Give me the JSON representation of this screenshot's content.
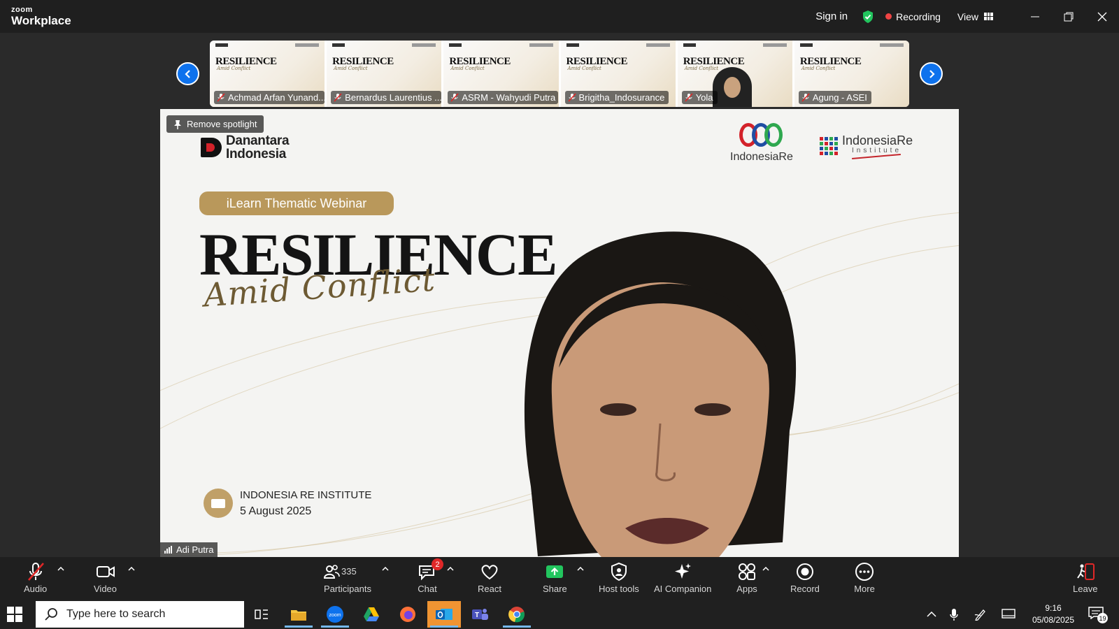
{
  "app": {
    "brand_top": "zoom",
    "brand_bottom": "Workplace"
  },
  "titlebar": {
    "signin": "Sign in",
    "recording": "Recording",
    "view": "View"
  },
  "participants_strip": [
    {
      "name": "Achmad Arfan Yunand..."
    },
    {
      "name": "Bernardus Laurentius ..."
    },
    {
      "name": "ASRM - Wahyudi Putra"
    },
    {
      "name": "Brigitha_Indosurance"
    },
    {
      "name": "Yola"
    },
    {
      "name": "Agung - ASEI"
    }
  ],
  "thumb_slide": {
    "title": "RESILIENCE",
    "sub": "Amid Conflict"
  },
  "stage": {
    "spotlight_btn": "Remove spotlight",
    "sponsor1_line1": "Danantara",
    "sponsor1_line2": "Indonesia",
    "sponsor2": "IndonesiaRe",
    "sponsor3_line1": "IndonesiaRe",
    "sponsor3_line2": "Institute",
    "pill": "iLearn Thematic Webinar",
    "headline": "RESILIENCE",
    "subheadline": "Amid Conflict",
    "venue_line1": "INDONESIA RE INSTITUTE",
    "venue_line2": "5 August 2025",
    "speaker": "Adi Putra"
  },
  "toolbar": {
    "audio": "Audio",
    "video": "Video",
    "participants": "Participants",
    "participants_count": "335",
    "chat": "Chat",
    "chat_badge": "2",
    "react": "React",
    "share": "Share",
    "host_tools": "Host tools",
    "ai_companion": "AI Companion",
    "apps": "Apps",
    "record": "Record",
    "more": "More",
    "leave": "Leave"
  },
  "taskbar": {
    "search_placeholder": "Type here to search",
    "time": "9:16",
    "date": "05/08/2025",
    "notifications": "19"
  },
  "colors": {
    "accent": "#0e72ed",
    "recording": "#ef4444",
    "gold": "#b9985b",
    "share": "#22c55e"
  }
}
